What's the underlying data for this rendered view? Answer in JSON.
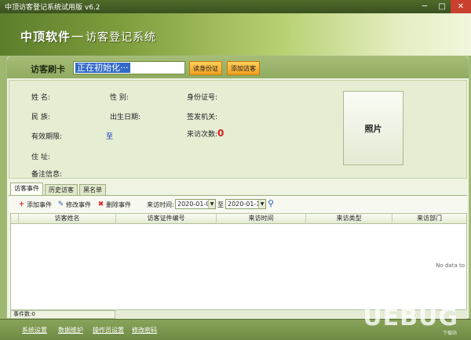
{
  "window": {
    "title": "中顶访客登记系统试用版 v6.2",
    "min": "─",
    "max": "□",
    "close": "✕"
  },
  "banner": {
    "brand": "中顶软件",
    "separator": "一",
    "system_name": "访客登记系统"
  },
  "card": {
    "label": "访客刷卡",
    "input_value": "正在初始化···",
    "read_id_button": "读身份证",
    "add_visitor_button": "添加访客"
  },
  "info": {
    "name_label": "姓    名:",
    "gender_label": "性    别:",
    "id_label": "身份证号:",
    "ethnic_label": "民    族:",
    "birth_label": "出生日期:",
    "authority_label": "签发机关:",
    "validity_label": "有效期限:",
    "validity_to": "至",
    "visits_label": "来访次数:",
    "visits_count": "0",
    "address_label": "住    址:",
    "remark_label": "备注信息:",
    "photo_label": "照片"
  },
  "tabs": [
    {
      "label": "访客事件"
    },
    {
      "label": "历史访客"
    },
    {
      "label": "黑名单"
    }
  ],
  "toolbar": {
    "add_event": "添加事件",
    "edit_event": "修改事件",
    "delete_event": "删除事件",
    "visit_time_label": "来访时间:",
    "date_from": "2020-01-09",
    "date_to_label": "至",
    "date_to": "2020-01-16"
  },
  "grid": {
    "columns": [
      "",
      "访客姓名",
      "访客证件编号",
      "来访时间",
      "来访类型",
      "来访部门"
    ],
    "no_data": "No data to"
  },
  "status": {
    "event_count": "事件数:0"
  },
  "bottom": [
    {
      "label": "系统设置"
    },
    {
      "label": "数据维护"
    },
    {
      "label": "操作员设置"
    },
    {
      "label": "修改密码"
    }
  ],
  "watermark": {
    "main": "UEBUG",
    "sub": "下载站"
  },
  "colors": {
    "accent_green": "#91ab62",
    "button_orange": "#f0a020",
    "count_red": "#d4201e"
  }
}
